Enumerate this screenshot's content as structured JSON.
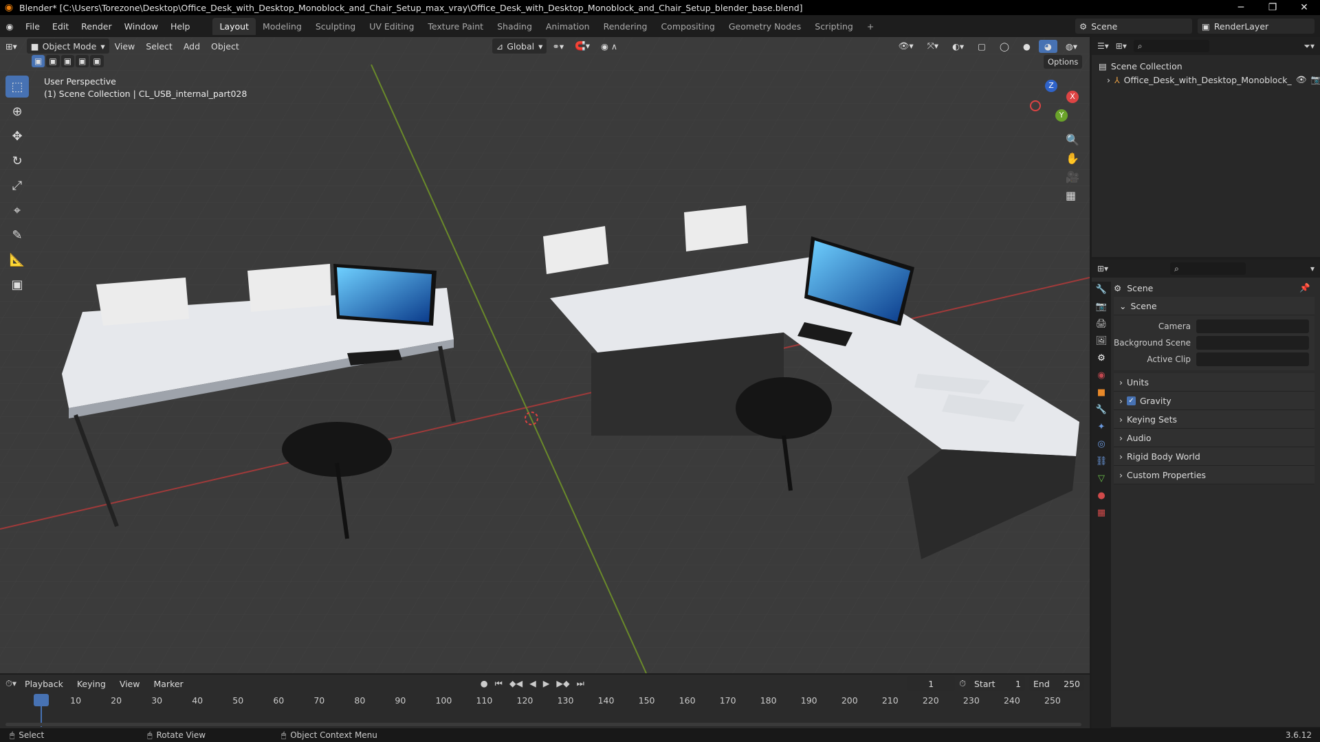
{
  "window": {
    "title": "Blender* [C:\\Users\\Torezone\\Desktop\\Office_Desk_with_Desktop_Monoblock_and_Chair_Setup_max_vray\\Office_Desk_with_Desktop_Monoblock_and_Chair_Setup_blender_base.blend]",
    "min": "─",
    "max": "❐",
    "close": "✕"
  },
  "menus": [
    "File",
    "Edit",
    "Render",
    "Window",
    "Help"
  ],
  "workspaces": [
    "Layout",
    "Modeling",
    "Sculpting",
    "UV Editing",
    "Texture Paint",
    "Shading",
    "Animation",
    "Rendering",
    "Compositing",
    "Geometry Nodes",
    "Scripting",
    "+"
  ],
  "scene_selector": "Scene",
  "renderlayer": "RenderLayer",
  "viewport": {
    "mode": "Object Mode",
    "menus": [
      "View",
      "Select",
      "Add",
      "Object"
    ],
    "transform": "Global",
    "options": "Options",
    "overlay_line1": "User Perspective",
    "overlay_line2": "(1) Scene Collection | CL_USB_internal_part028",
    "gizmo": {
      "x": "X",
      "y": "Y",
      "z": "Z"
    }
  },
  "outliner": {
    "collection": "Scene Collection",
    "object": "Office_Desk_with_Desktop_Monoblock_"
  },
  "properties": {
    "header": "Scene",
    "panel": "Scene",
    "camera_label": "Camera",
    "bg_scene_label": "Background Scene",
    "active_clip_label": "Active Clip",
    "sections": [
      "Units",
      "Gravity",
      "Keying Sets",
      "Audio",
      "Rigid Body World",
      "Custom Properties"
    ]
  },
  "timeline": {
    "menus": [
      "Playback",
      "Keying",
      "View",
      "Marker"
    ],
    "current_frame": "1",
    "start_label": "Start",
    "start": "1",
    "end_label": "End",
    "end": "250",
    "ticks": [
      "1",
      "10",
      "20",
      "30",
      "40",
      "50",
      "60",
      "70",
      "80",
      "90",
      "100",
      "110",
      "120",
      "130",
      "140",
      "150",
      "160",
      "170",
      "180",
      "190",
      "200",
      "210",
      "220",
      "230",
      "240",
      "250"
    ]
  },
  "status": {
    "select": "Select",
    "rotate": "Rotate View",
    "context": "Object Context Menu",
    "version": "3.6.12"
  }
}
